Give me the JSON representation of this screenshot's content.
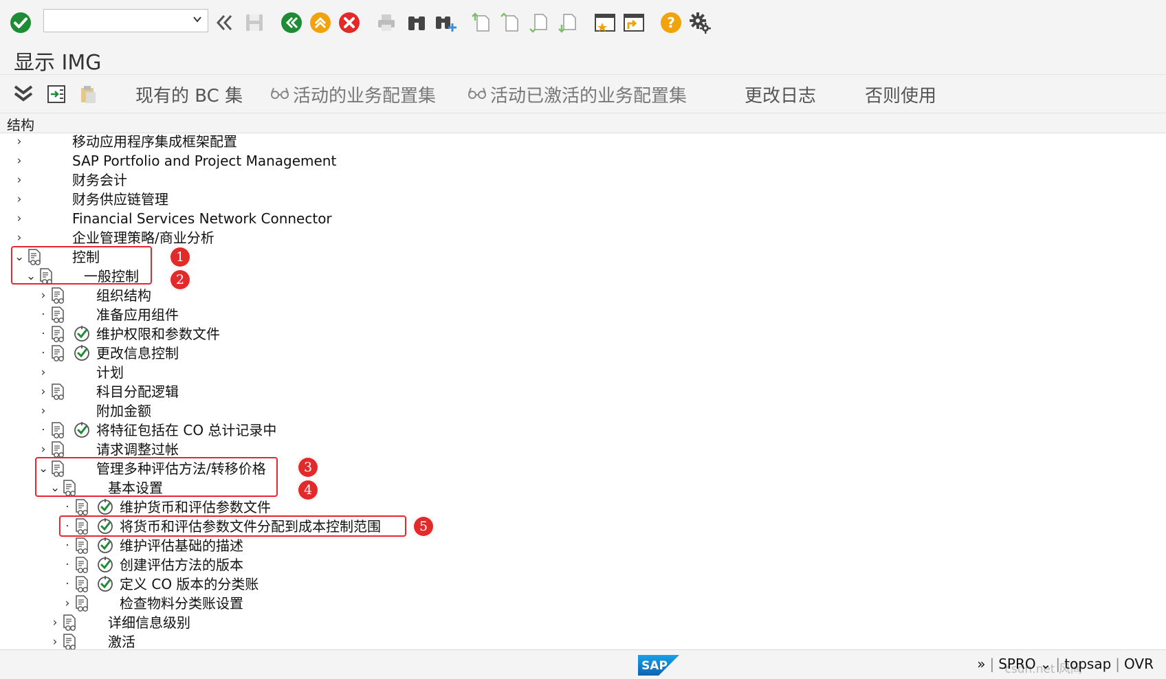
{
  "top_toolbar": {
    "command_field_value": "",
    "icons": [
      "check-icon",
      "back-double-arrow-icon",
      "save-icon",
      "back-icon",
      "exit-icon",
      "cancel-icon",
      "print-icon",
      "find-icon",
      "find-next-icon",
      "first-page-icon",
      "previous-page-icon",
      "next-page-icon",
      "last-page-icon",
      "create-session-icon",
      "shortcut-icon",
      "help-icon",
      "settings-gear-icon"
    ]
  },
  "title": "显示 IMG",
  "app_toolbar": {
    "existing_bc_sets": "现有的 BC 集",
    "active_bc_sets": "活动的业务配置集",
    "activated_bc_sets": "活动已激活的业务配置集",
    "change_log": "更改日志",
    "otherwise_use": "否则使用"
  },
  "structure_header": "结构",
  "tree": [
    {
      "label": "移动应用程序集成框架配置"
    },
    {
      "label": "SAP Portfolio and Project Management"
    },
    {
      "label": "财务会计"
    },
    {
      "label": "财务供应链管理"
    },
    {
      "label": "Financial Services Network Connector"
    },
    {
      "label": "企业管理策略/商业分析"
    },
    {
      "label": "控制"
    },
    {
      "label": "一般控制"
    },
    {
      "label": "组织结构"
    },
    {
      "label": "准备应用组件"
    },
    {
      "label": "维护权限和参数文件"
    },
    {
      "label": "更改信息控制"
    },
    {
      "label": "计划"
    },
    {
      "label": "科目分配逻辑"
    },
    {
      "label": "附加金额"
    },
    {
      "label": "将特征包括在 CO 总计记录中"
    },
    {
      "label": "请求调整过帐"
    },
    {
      "label": "管理多种评估方法/转移价格"
    },
    {
      "label": "基本设置"
    },
    {
      "label": "维护货币和评估参数文件"
    },
    {
      "label": "将货币和评估参数文件分配到成本控制范围"
    },
    {
      "label": "维护评估基础的描述"
    },
    {
      "label": "创建评估方法的版本"
    },
    {
      "label": "定义 CO 版本的分类账"
    },
    {
      "label": "检查物料分类账设置"
    },
    {
      "label": "详细信息级别"
    },
    {
      "label": "激活"
    }
  ],
  "badges": [
    "1",
    "2",
    "3",
    "4",
    "5"
  ],
  "status_bar": {
    "logo": "SAP",
    "transaction": "SPRO",
    "system": "topsap",
    "mode": "OVR",
    "watermark": "csdn.net 风间"
  },
  "colors": {
    "accent_red": "#e32a2a",
    "confirm_green": "#1e8c34",
    "help_yellow": "#f0a30a"
  }
}
